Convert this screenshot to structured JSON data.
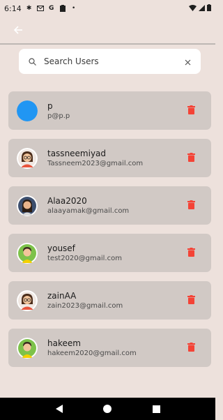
{
  "status_bar": {
    "time": "6:14",
    "left_icons": [
      "settings-icon",
      "mail-icon",
      "google-icon",
      "clipboard-icon",
      "dot-icon"
    ],
    "right_icons": [
      "wifi-icon",
      "signal-icon",
      "battery-icon"
    ]
  },
  "app_bar": {
    "back_icon": "arrow-left-icon"
  },
  "search": {
    "placeholder": "Search Users",
    "value": ""
  },
  "users": [
    {
      "name": "p",
      "email": "p@p.p",
      "avatar": "blue-circle"
    },
    {
      "name": "tassneemiyad",
      "email": "Tassneem2023@gmail.com",
      "avatar": "woman-glasses"
    },
    {
      "name": "Alaa2020",
      "email": "alaayamak@gmail.com",
      "avatar": "woman-dark"
    },
    {
      "name": "yousef",
      "email": "test2020@gmail.com",
      "avatar": "man-green"
    },
    {
      "name": "zainAA",
      "email": "zain2023@gmail.com",
      "avatar": "woman-glasses"
    },
    {
      "name": "hakeem",
      "email": "hakeem2020@gmail.com",
      "avatar": "man-green"
    }
  ],
  "colors": {
    "background": "#ede1dc",
    "card": "#d1c9c5",
    "delete": "#f44336",
    "avatar_blue": "#2196f3"
  },
  "nav": {
    "icons": [
      "back-triangle-icon",
      "home-circle-icon",
      "recents-square-icon"
    ]
  }
}
